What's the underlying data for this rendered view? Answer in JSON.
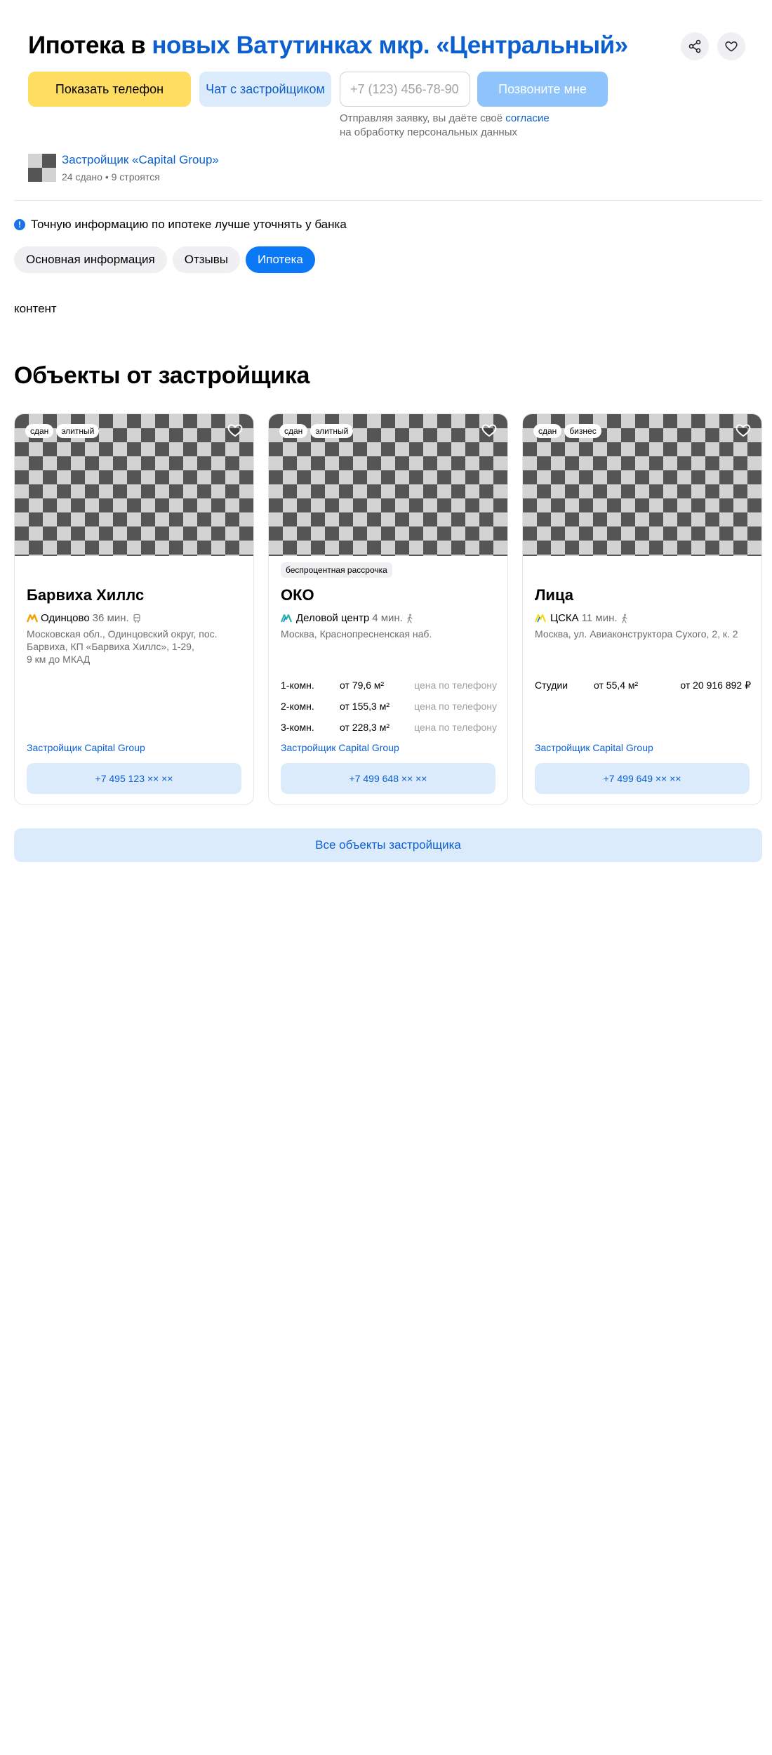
{
  "header": {
    "title_prefix": "Ипотека в ",
    "title_link": "новых Ватутинках мкр. «Центральный»",
    "share_icon": "share-icon",
    "favorite_icon": "heart-icon"
  },
  "actions": {
    "show_phone": "Показать телефон",
    "chat": "Чат с застройщиком",
    "phone_placeholder": "+7 (123) 456-78-90",
    "call_me": "Позвоните мне",
    "consent_before": "Отправляя заявку, вы даёте своё ",
    "consent_link": "согласие",
    "consent_after": "на обработку персональных данных"
  },
  "developer": {
    "name": "Застройщик «Capital Group»",
    "stats": "24 сдано • 9 строятся"
  },
  "notice": {
    "icon": "!",
    "text": "Точную информацию по ипотеке лучше уточнять у банка"
  },
  "tabs": [
    {
      "label": "Основная информация"
    },
    {
      "label": "Отзывы"
    },
    {
      "label": "Ипотека"
    }
  ],
  "active_tab": "Ипотека",
  "content_text": "контент",
  "section_title": "Объекты от застройщика",
  "cards": [
    {
      "badges": [
        "сдан",
        "элитный"
      ],
      "promo": "",
      "name": "Барвиха Хиллс",
      "metro_color": "#f4a100",
      "station": "Одинцово",
      "time": "36 мин.",
      "transport_icon": "bus-icon",
      "address": "Московская обл., Одинцовский округ, пос. Барвиха, КП «Барвиха Хиллс», 1-29,",
      "address_extra": "9 км до МКАД",
      "prices": [],
      "developer": "Застройщик Capital Group",
      "phone": "+7 495 123 ×× ××"
    },
    {
      "badges": [
        "сдан",
        "элитный"
      ],
      "promo": "беспроцентная рассрочка",
      "name": "ОКО",
      "metro_color": "#2db2a6",
      "station": "Деловой центр",
      "time": "4 мин.",
      "transport_icon": "walk-icon",
      "address": "Москва, Краснопресненская наб.",
      "address_extra": "",
      "prices": [
        {
          "rooms": "1-комн.",
          "area": "от 79,6 м²",
          "price": "цена по телефону"
        },
        {
          "rooms": "2-комн.",
          "area": "от 155,3 м²",
          "price": "цена по телефону"
        },
        {
          "rooms": "3-комн.",
          "area": "от 228,3 м²",
          "price": "цена по телефону"
        }
      ],
      "developer": "Застройщик Capital Group",
      "phone": "+7 499 648 ×× ××"
    },
    {
      "badges": [
        "сдан",
        "бизнес"
      ],
      "promo": "",
      "name": "Лица",
      "metro_color": "#f9d90f",
      "station": "ЦСКА",
      "time": "11 мин.",
      "transport_icon": "walk-icon",
      "address": "Москва, ул. Авиаконструктора Сухого, 2, к. 2",
      "address_extra": "",
      "prices": [
        {
          "rooms": "Студии",
          "area": "от 55,4 м²",
          "price": "от 20 916 892 ₽"
        }
      ],
      "developer": "Застройщик Capital Group",
      "phone": "+7 499 649 ×× ××"
    }
  ],
  "all_objects_button": "Все объекты застройщика",
  "colors": {
    "link": "#0b5fcf",
    "accent_yellow": "#ffdd60",
    "active_tab": "#0b79f5",
    "light_blue": "#dcebfc"
  }
}
